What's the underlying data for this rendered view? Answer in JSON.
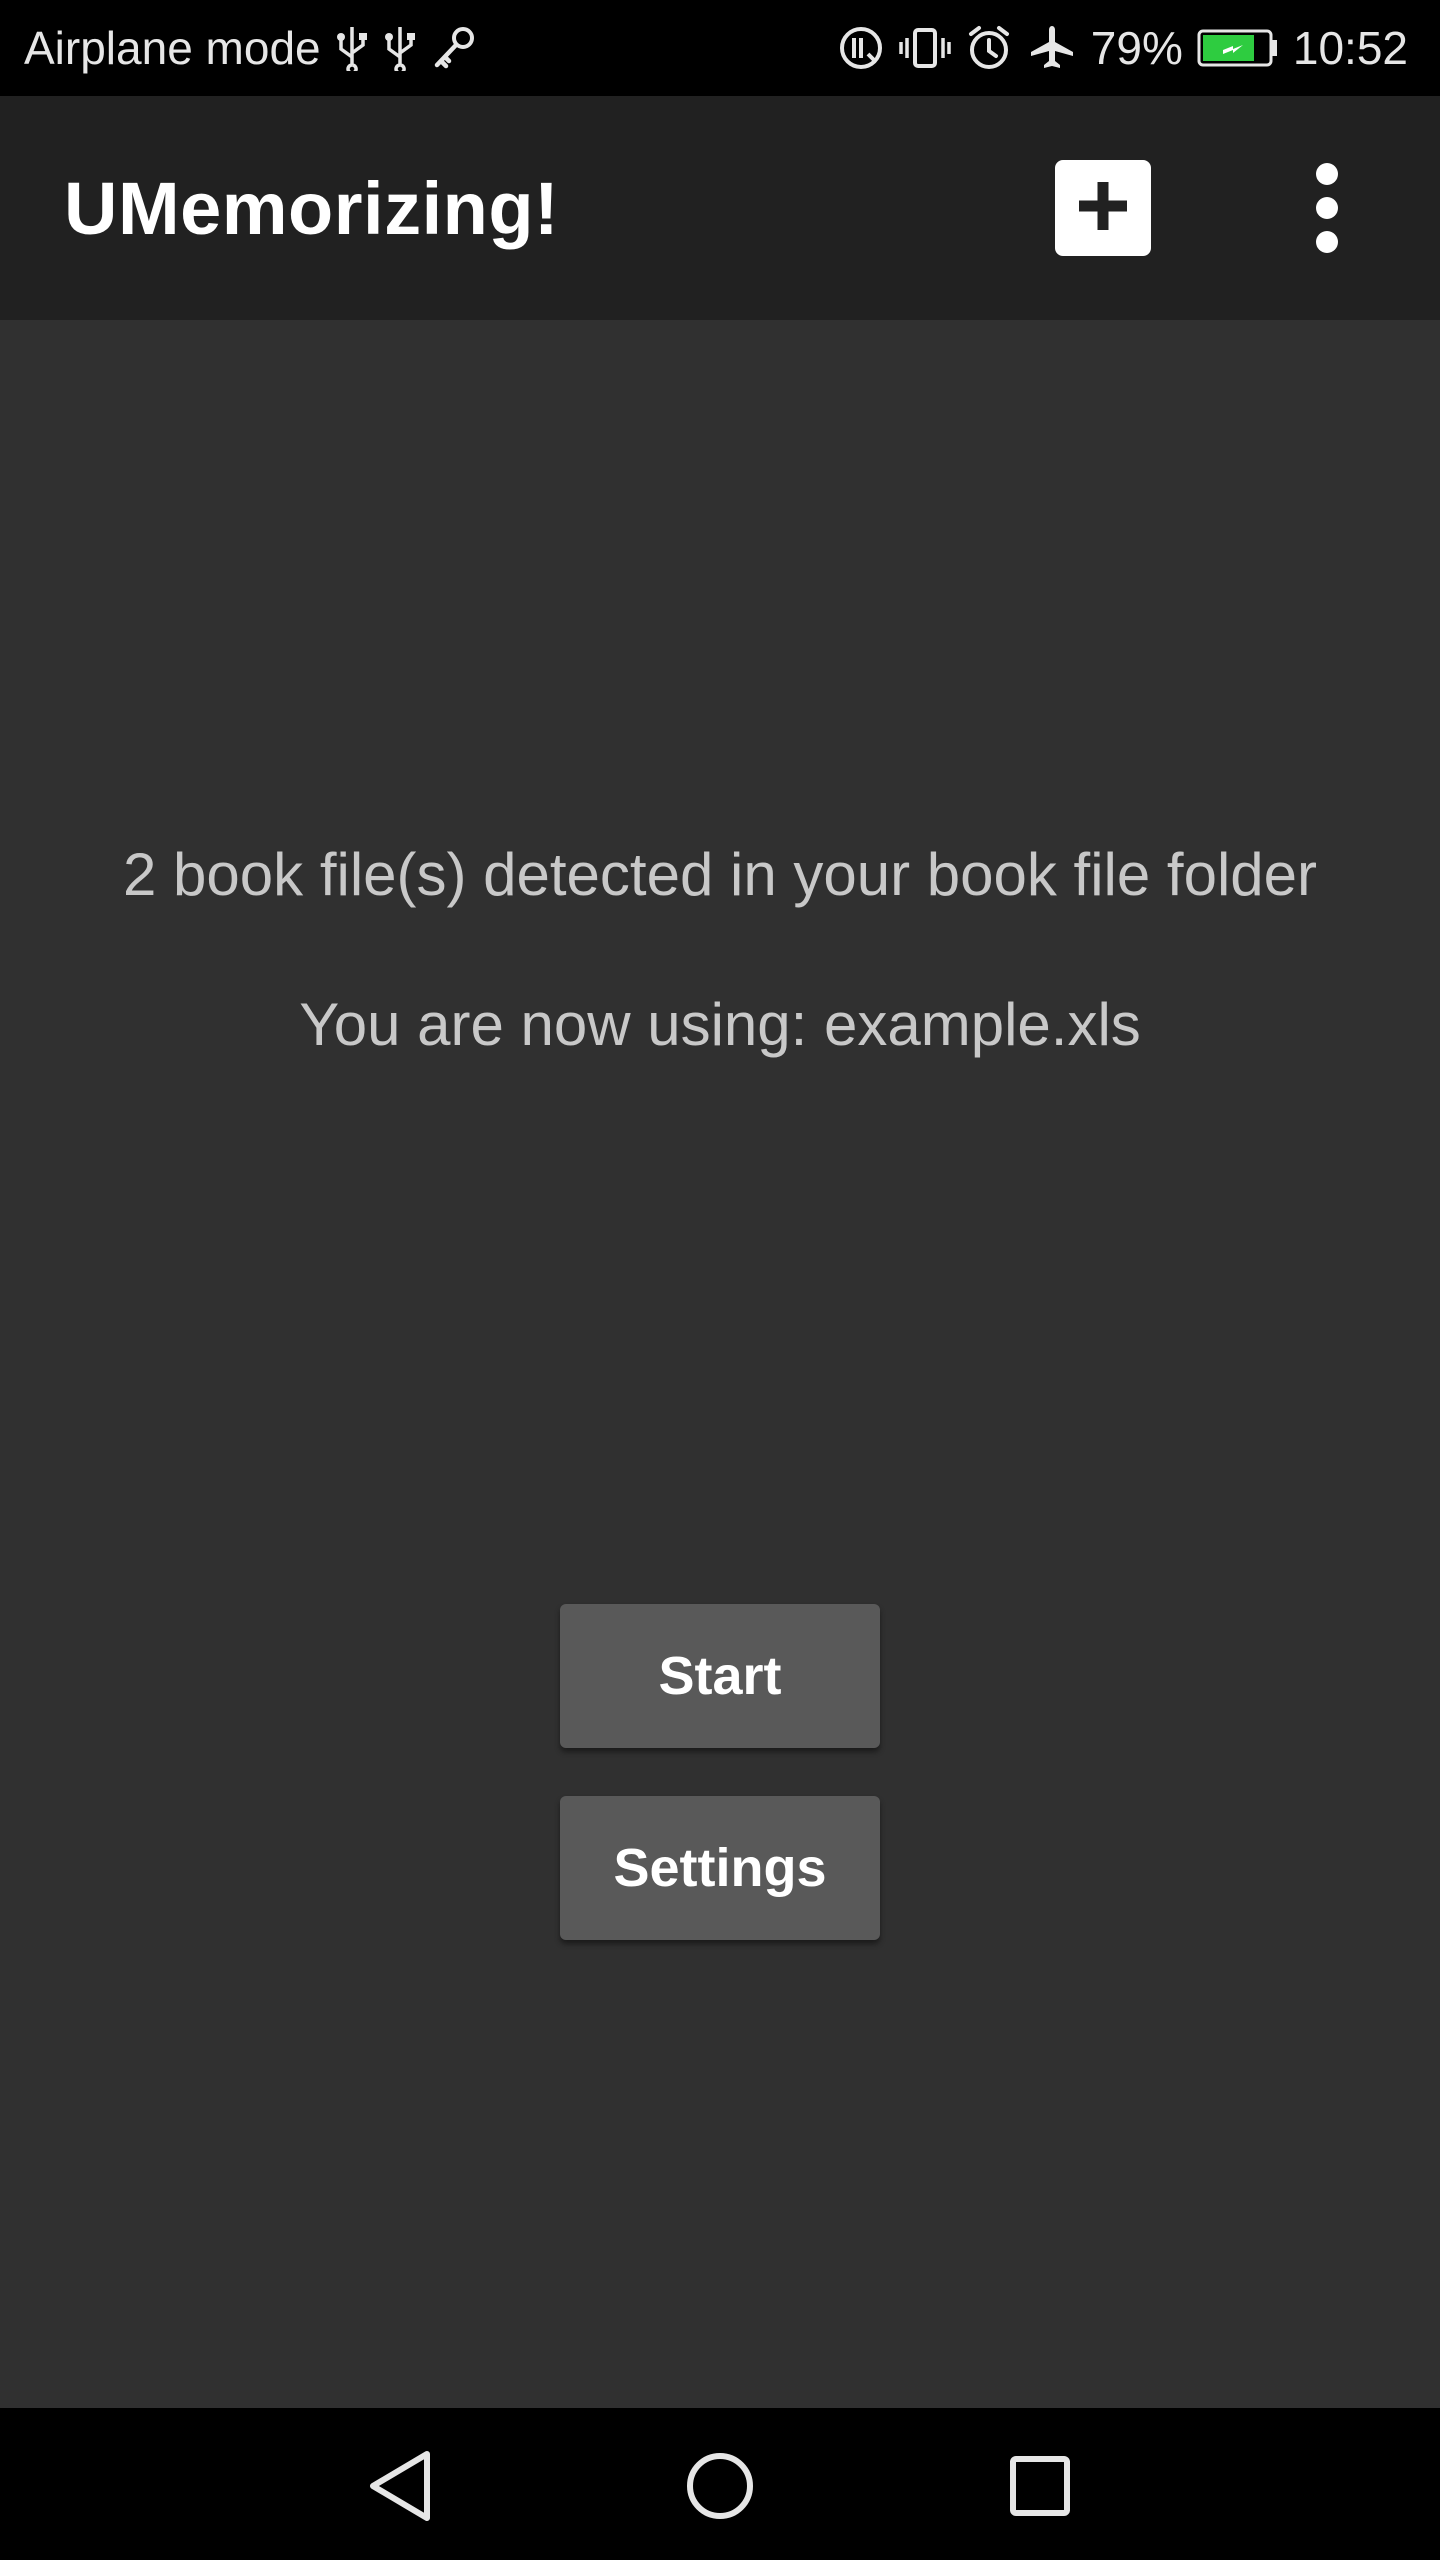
{
  "status_bar": {
    "left_text": "Airplane mode",
    "battery_percent": "79%",
    "time": "10:52",
    "battery_level": 0.79,
    "battery_color": "#2ecc40",
    "icons_left": [
      "usb-icon",
      "usb-icon",
      "key-icon"
    ],
    "icons_right": [
      "data-saver-icon",
      "vibrate-icon",
      "alarm-icon",
      "airplane-icon",
      "battery-icon"
    ]
  },
  "app_bar": {
    "title": "UMemorizing!",
    "actions": [
      "add-icon",
      "overflow-menu-icon"
    ]
  },
  "main": {
    "detected_text": "2 book file(s) detected in your book file folder",
    "using_text": "You are now using: example.xls",
    "start_label": "Start",
    "settings_label": "Settings"
  },
  "nav_bar": {
    "buttons": [
      "back-icon",
      "home-icon",
      "recent-apps-icon"
    ]
  },
  "colors": {
    "background": "#303030",
    "app_bar": "#212121",
    "button": "#595959",
    "text_secondary": "#c8c8c8"
  }
}
